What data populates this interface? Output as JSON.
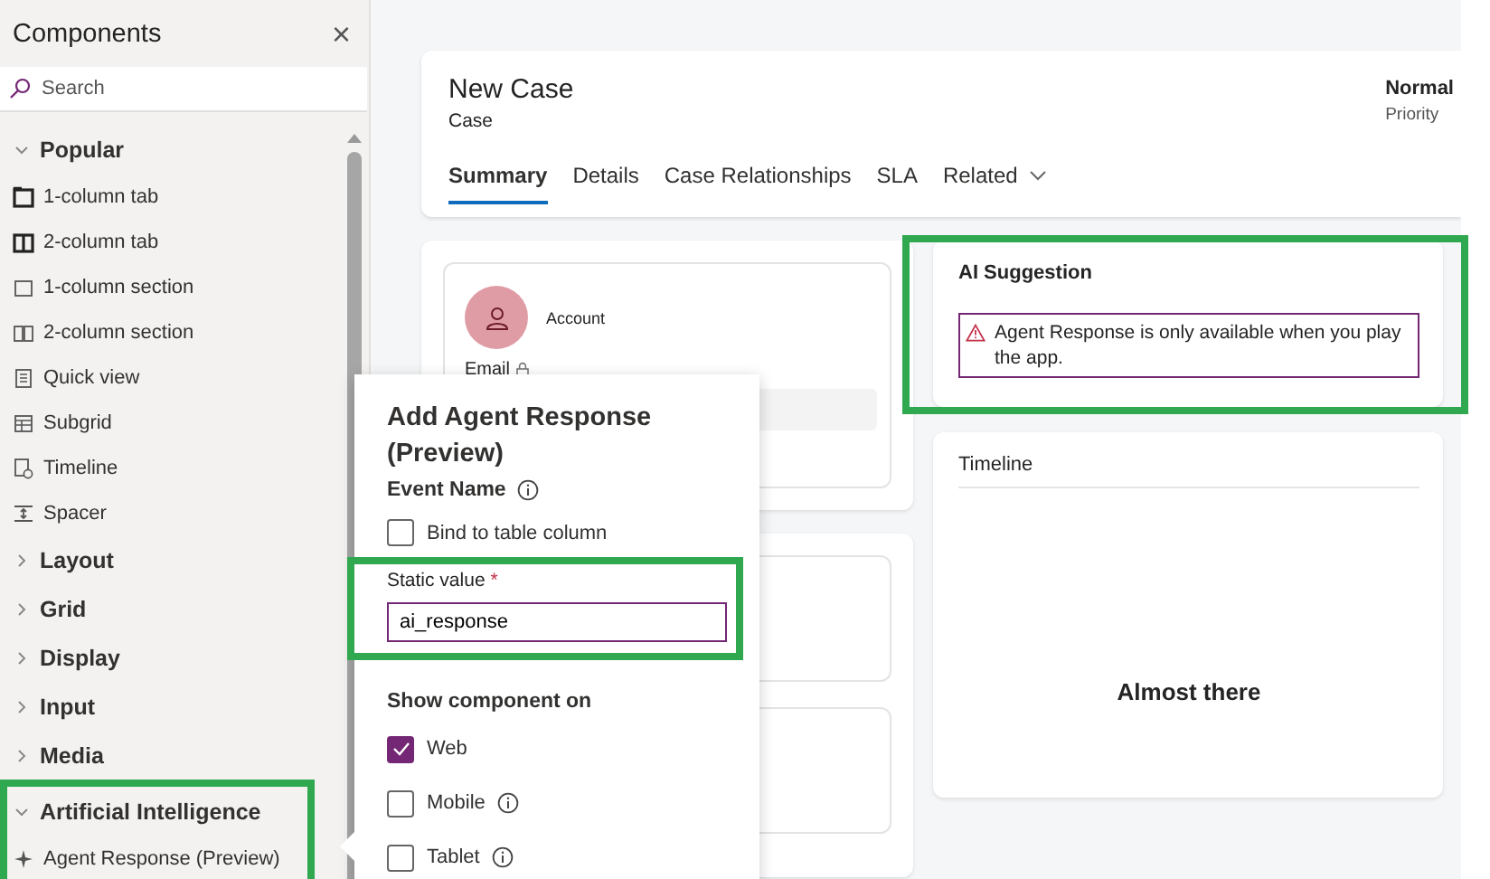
{
  "sidebar": {
    "title": "Components",
    "close": "×",
    "search": {
      "placeholder": "Search"
    },
    "groups": [
      {
        "label": "Popular",
        "expanded": true,
        "highlighted": false,
        "children": [
          {
            "label": "1-column tab"
          },
          {
            "label": "2-column tab"
          },
          {
            "label": "1-column section"
          },
          {
            "label": "2-column section"
          },
          {
            "label": "Quick view"
          },
          {
            "label": "Subgrid"
          },
          {
            "label": "Timeline"
          },
          {
            "label": "Spacer"
          }
        ]
      },
      {
        "label": "Layout",
        "expanded": false,
        "highlighted": false
      },
      {
        "label": "Grid",
        "expanded": false,
        "highlighted": false
      },
      {
        "label": "Display",
        "expanded": false,
        "highlighted": false
      },
      {
        "label": "Input",
        "expanded": false,
        "highlighted": false
      },
      {
        "label": "Media",
        "expanded": false,
        "highlighted": false
      },
      {
        "label": "Artificial Intelligence",
        "expanded": true,
        "highlighted": true,
        "children": [
          {
            "label": "Agent Response (Preview)"
          }
        ]
      }
    ]
  },
  "header": {
    "title": "New Case",
    "subtitle": "Case",
    "priority_value": "Normal",
    "priority_label": "Priority",
    "tabs": [
      {
        "label": "Summary",
        "selected": true
      },
      {
        "label": "Details",
        "selected": false
      },
      {
        "label": "Case Relationships",
        "selected": false
      },
      {
        "label": "SLA",
        "selected": false
      },
      {
        "label": "Related",
        "selected": false,
        "dropdown": true
      }
    ]
  },
  "account_card": {
    "label": "Account",
    "email_label": "Email"
  },
  "ai_suggestion": {
    "title": "AI Suggestion",
    "message": "Agent Response is only available when you play the app.",
    "highlighted": true
  },
  "timeline": {
    "title": "Timeline",
    "message": "Almost there"
  },
  "popup": {
    "title": "Add Agent Response (Preview)",
    "event_name_label": "Event Name",
    "bind_checkbox": {
      "label": "Bind to table column",
      "checked": false
    },
    "static_value": {
      "label": "Static value",
      "required_mark": "*",
      "value": "ai_response",
      "highlighted": true
    },
    "show_label": "Show component on",
    "platforms": [
      {
        "label": "Web",
        "checked": true,
        "info": false
      },
      {
        "label": "Mobile",
        "checked": false,
        "info": true
      },
      {
        "label": "Tablet",
        "checked": false,
        "info": true
      }
    ]
  }
}
